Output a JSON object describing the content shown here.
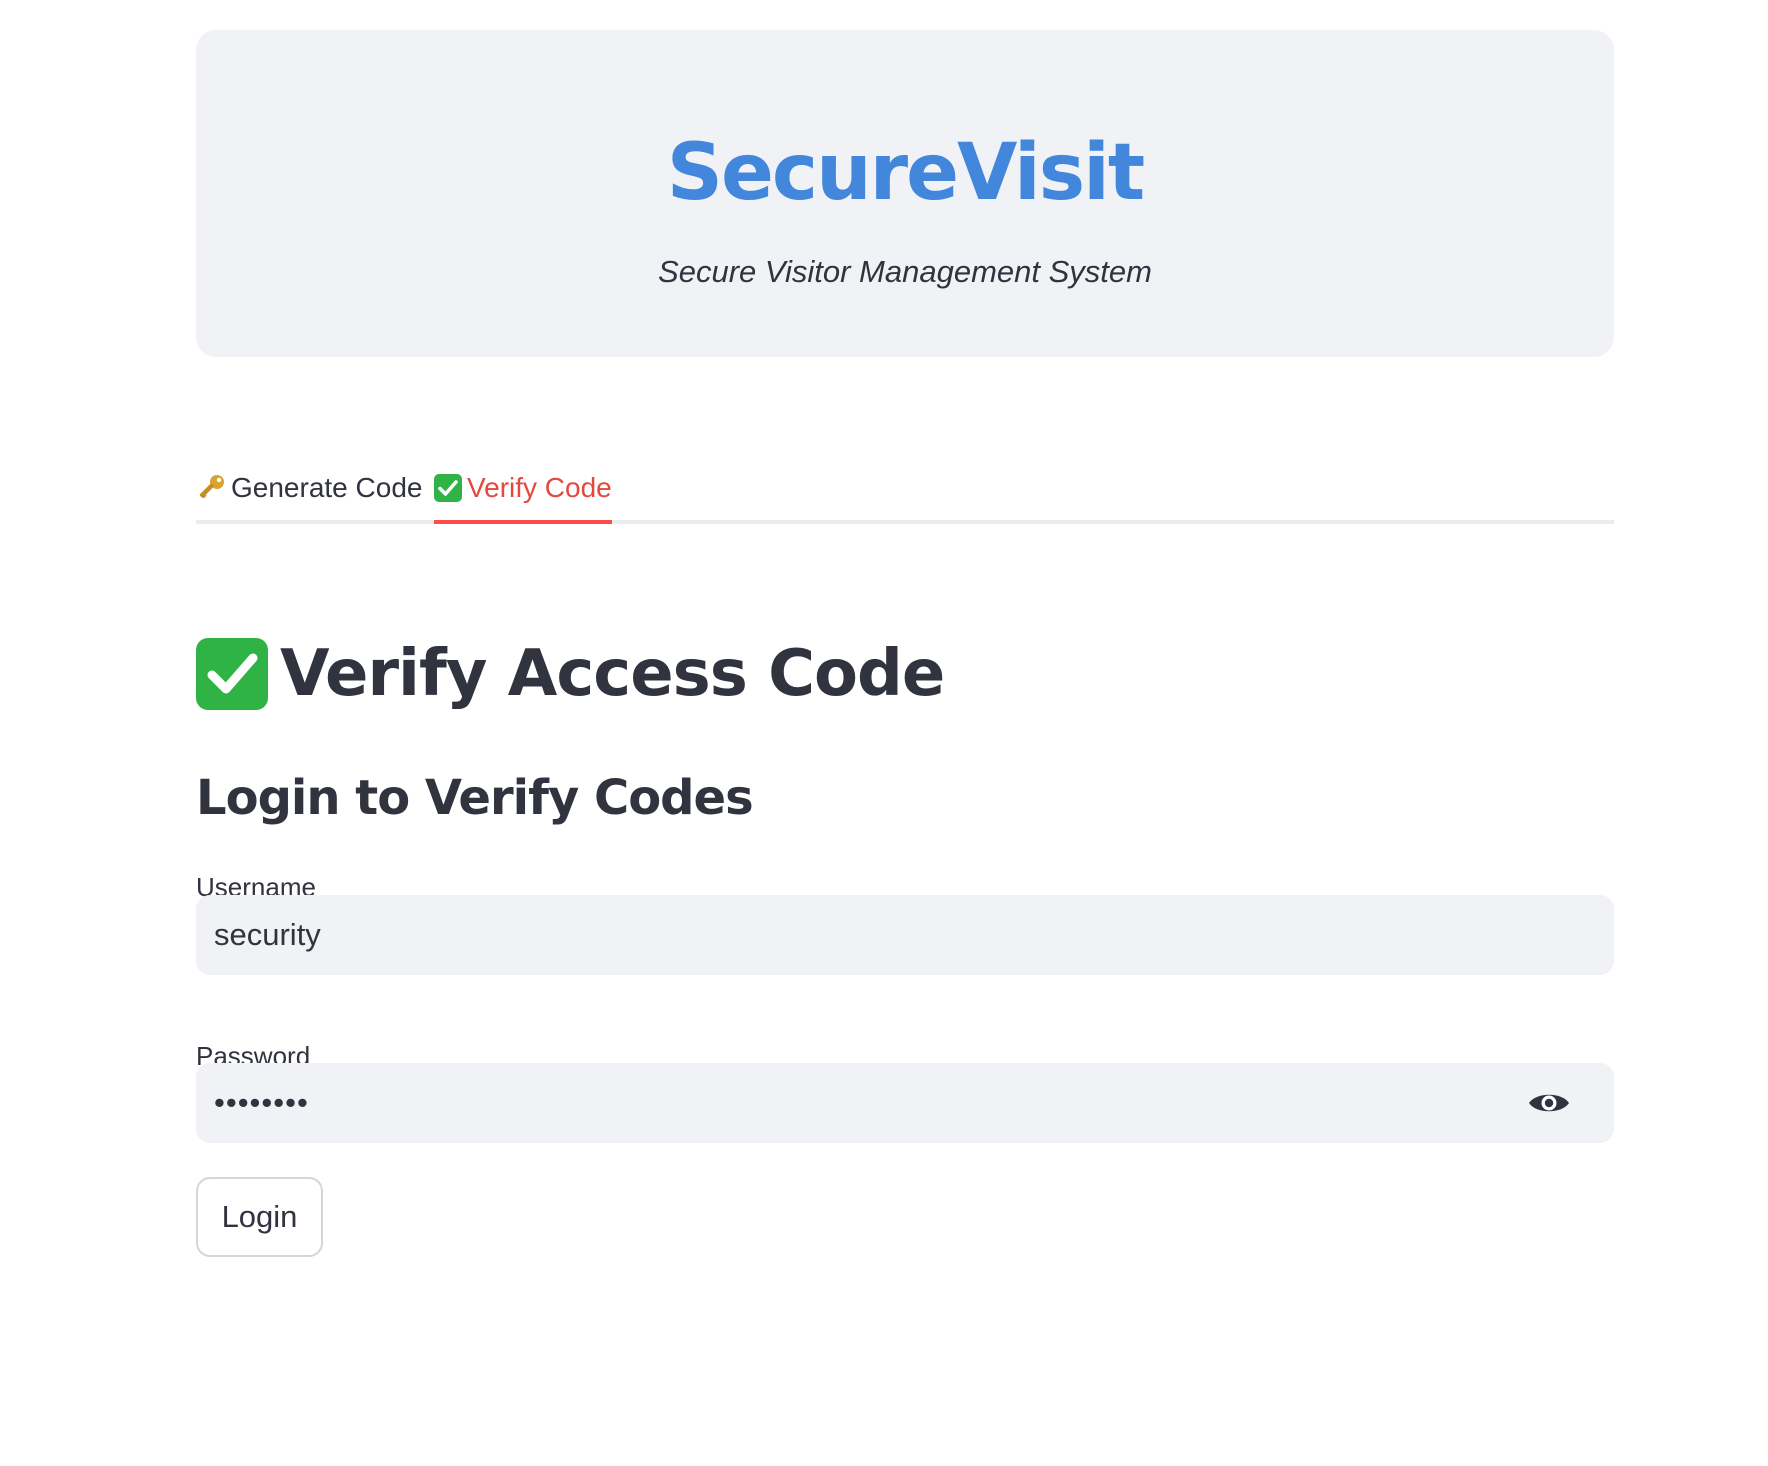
{
  "header": {
    "title": "SecureVisit",
    "subtitle": "Secure Visitor Management System"
  },
  "tabs": [
    {
      "label": "Generate Code",
      "icon": "key-icon",
      "active": false
    },
    {
      "label": "Verify Code",
      "icon": "check-mark-icon",
      "active": true
    }
  ],
  "main": {
    "page_title": "Verify Access Code",
    "section_title": "Login to Verify Codes",
    "username": {
      "label": "Username",
      "value": "security"
    },
    "password": {
      "label": "Password",
      "value": "••••••••"
    },
    "login_button": "Login"
  },
  "colors": {
    "brand": "#4287db",
    "active_tab": "#ff4b4b",
    "check_green": "#2fb344",
    "card_bg": "#f0f2f6"
  }
}
